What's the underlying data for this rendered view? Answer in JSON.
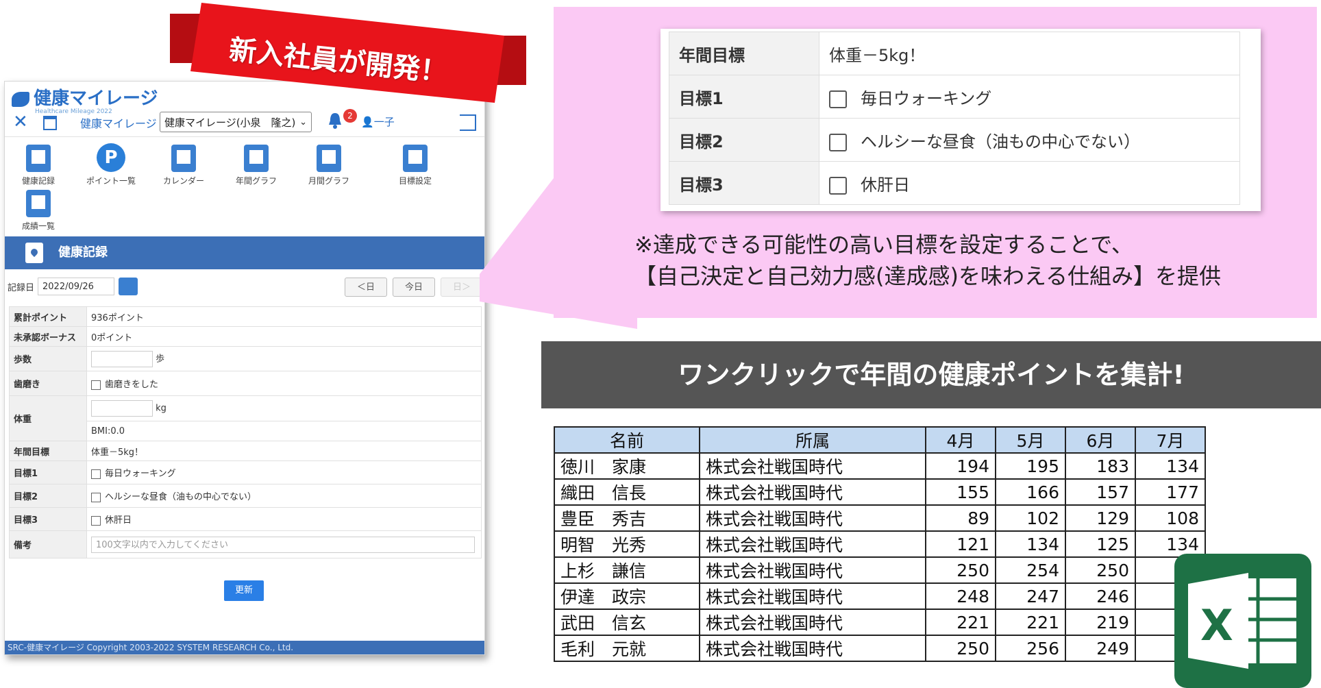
{
  "ribbon": {
    "text": "新入社員が開発！",
    "color": "#e8141b"
  },
  "app": {
    "logo": {
      "name": "健康マイレージ",
      "sub": "Healthcare Mileage 2022"
    },
    "topbar": {
      "close": "✕",
      "app_name": "健康マイレージ",
      "select_value": "健康マイレージ(小泉　隆之)",
      "badge": "2",
      "user": "一子"
    },
    "menu": [
      {
        "label": "健康記録"
      },
      {
        "label": "ポイント一覧",
        "glyph": "P"
      },
      {
        "label": "カレンダー"
      },
      {
        "label": "年間グラフ"
      },
      {
        "label": "月間グラフ"
      },
      {
        "label": "目標設定"
      },
      {
        "label": "成績一覧"
      }
    ],
    "section_title": "健康記録",
    "datebar": {
      "label": "記録日",
      "date": "2022/09/26",
      "prev": "＜日",
      "today": "今日",
      "next": "日＞"
    },
    "form": {
      "total_points_label": "累計ポイント",
      "total_points": "936ポイント",
      "unapproved_label": "未承認ボーナス",
      "unapproved": "0ポイント",
      "steps_label": "歩数",
      "steps_unit": "歩",
      "teeth_label": "歯磨き",
      "teeth_option": "歯磨きをした",
      "weight_label": "体重",
      "weight_unit": "kg",
      "bmi": "BMI:0.0",
      "annual_goal_label": "年間目標",
      "annual_goal": "体重－5kg！",
      "goal1_label": "目標1",
      "goal1": "毎日ウォーキング",
      "goal2_label": "目標2",
      "goal2": "ヘルシーな昼食（油もの中心でない）",
      "goal3_label": "目標3",
      "goal3": "休肝日",
      "remarks_label": "備考",
      "remarks_placeholder": "100文字以内で入力してください"
    },
    "update_button": "更新",
    "footer": "SRC-健康マイレージ Copyright 2003-2022 SYSTEM RESEARCH Co., Ltd."
  },
  "callout": {
    "rows": [
      {
        "label": "年間目標",
        "value": "体重－5kg！",
        "checkbox": false
      },
      {
        "label": "目標1",
        "value": "毎日ウォーキング",
        "checkbox": true
      },
      {
        "label": "目標2",
        "value": "ヘルシーな昼食（油もの中心でない）",
        "checkbox": true
      },
      {
        "label": "目標3",
        "value": "休肝日",
        "checkbox": true
      }
    ],
    "note_line1": "※達成できる可能性の高い目標を設定することで、",
    "note_line2": "【自己決定と自己効力感(達成感)を味わえる仕組み】を提供",
    "bg_color": "#fbc9f4"
  },
  "banner": {
    "text": "ワンクリックで年間の健康ポイントを集計!"
  },
  "points_table": {
    "headers": [
      "名前",
      "所属",
      "4月",
      "5月",
      "6月",
      "7月"
    ],
    "rows": [
      [
        "徳川　家康",
        "株式会社戦国時代",
        "194",
        "195",
        "183",
        "134"
      ],
      [
        "織田　信長",
        "株式会社戦国時代",
        "155",
        "166",
        "157",
        "177"
      ],
      [
        "豊臣　秀吉",
        "株式会社戦国時代",
        "89",
        "102",
        "129",
        "108"
      ],
      [
        "明智　光秀",
        "株式会社戦国時代",
        "121",
        "134",
        "125",
        "134"
      ],
      [
        "上杉　謙信",
        "株式会社戦国時代",
        "250",
        "254",
        "250",
        "2"
      ],
      [
        "伊達　政宗",
        "株式会社戦国時代",
        "248",
        "247",
        "246",
        "2"
      ],
      [
        "武田　信玄",
        "株式会社戦国時代",
        "221",
        "221",
        "219",
        "2"
      ],
      [
        "毛利　元就",
        "株式会社戦国時代",
        "250",
        "256",
        "249",
        "2"
      ]
    ]
  },
  "excel_icon": {
    "letter": "X",
    "color": "#1e7145"
  }
}
